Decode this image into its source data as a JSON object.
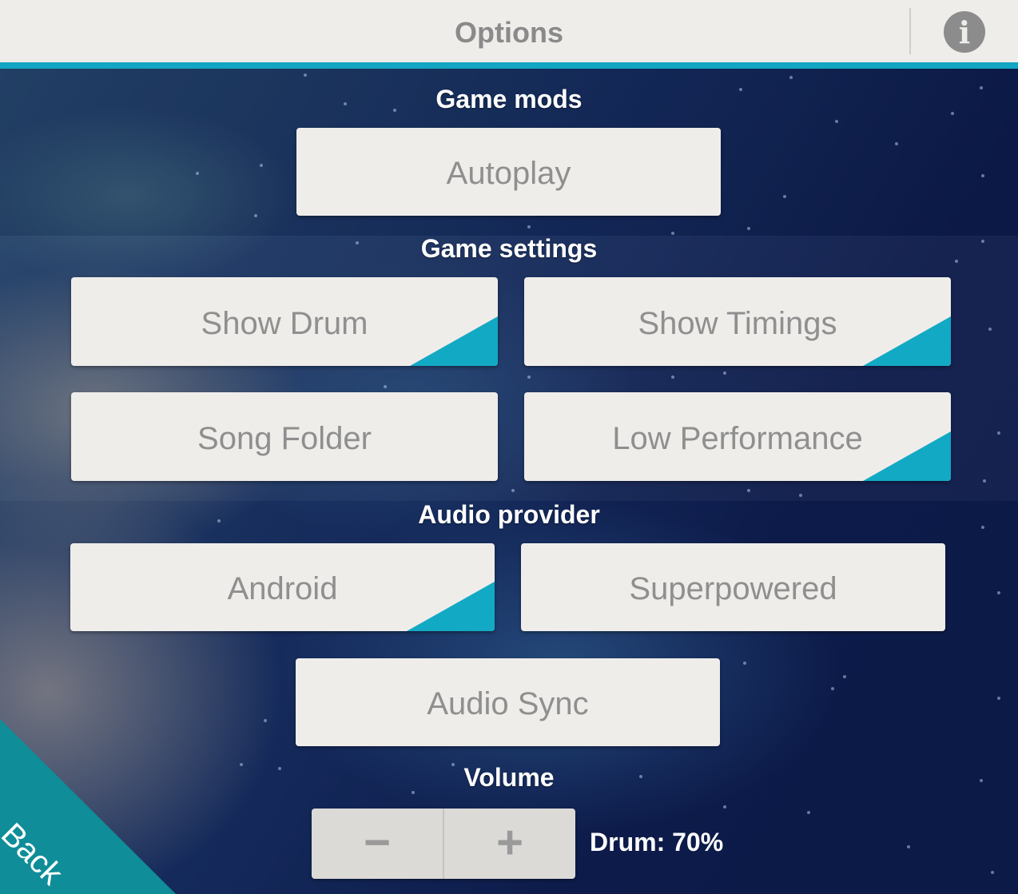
{
  "header": {
    "title": "Options",
    "info_icon": "info-icon"
  },
  "sections": {
    "game_mods": "Game mods",
    "game_settings": "Game settings",
    "audio_provider": "Audio provider",
    "volume": "Volume"
  },
  "buttons": {
    "autoplay": "Autoplay",
    "show_drum": "Show Drum",
    "show_timings": "Show Timings",
    "song_folder": "Song Folder",
    "low_performance": "Low Performance",
    "android": "Android",
    "superpowered": "Superpowered",
    "audio_sync": "Audio Sync"
  },
  "toggles": {
    "show_drum": true,
    "show_timings": true,
    "low_performance": true,
    "android": true,
    "superpowered": false,
    "autoplay": false
  },
  "volume": {
    "minus": "−",
    "plus": "+",
    "status": "Drum: 70%",
    "level_percent": 70
  },
  "back": "Back",
  "colors": {
    "accent": "#12a6c2",
    "back_bg": "#0f8d99",
    "button_bg": "#efedea",
    "button_text": "#8f8f8f"
  }
}
